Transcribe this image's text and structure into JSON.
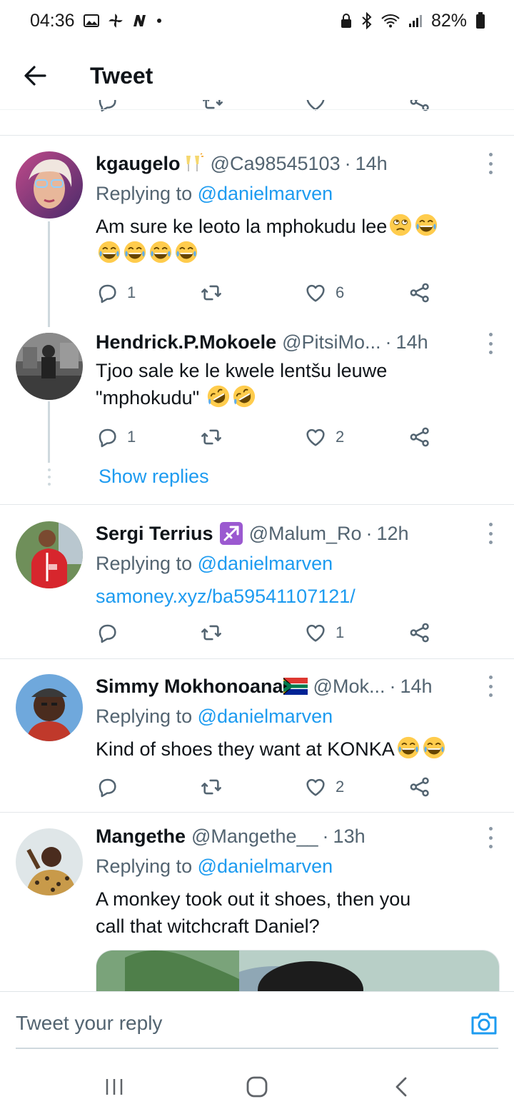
{
  "status": {
    "time": "04:36",
    "battery": "82%"
  },
  "header": {
    "title": "Tweet"
  },
  "tweets": [
    {
      "name": "kgaugelo",
      "handle": "@Ca98545103",
      "time": "14h",
      "reply_prefix": "Replying to",
      "reply_to": "@danielmarven",
      "text": "Am sure ke leoto la mphokudu lee",
      "replies": "1",
      "likes": "6"
    },
    {
      "name": "Hendrick.P.Mokoele",
      "handle": "@PitsiMo...",
      "time": "14h",
      "text_line1": "Tjoo sale ke le kwele lentšu leuwe",
      "text_line2": "\"mphokudu\"",
      "replies": "1",
      "likes": "2"
    },
    {
      "name": "Sergi Terrius",
      "handle": "@Malum_Ro",
      "time": "12h",
      "reply_prefix": "Replying to",
      "reply_to": "@danielmarven",
      "link": "samoney.xyz/ba59541107121/",
      "likes": "1"
    },
    {
      "name": "Simmy Mokhonoana",
      "handle": "@Mok...",
      "time": "14h",
      "reply_prefix": "Replying to",
      "reply_to": "@danielmarven",
      "text": "Kind of shoes they want at KONKA",
      "likes": "2"
    },
    {
      "name": "Mangethe",
      "handle": "@Mangethe__",
      "time": "13h",
      "reply_prefix": "Replying to",
      "reply_to": "@danielmarven",
      "text_line1": "A monkey took out it shoes, then you",
      "text_line2": "call that witchcraft Daniel?"
    }
  ],
  "thread": {
    "show_replies": "Show replies"
  },
  "compose": {
    "placeholder": "Tweet your reply"
  },
  "colors": {
    "accent": "#1d9bf0",
    "text": "#0f1419",
    "secondary": "#536471"
  }
}
